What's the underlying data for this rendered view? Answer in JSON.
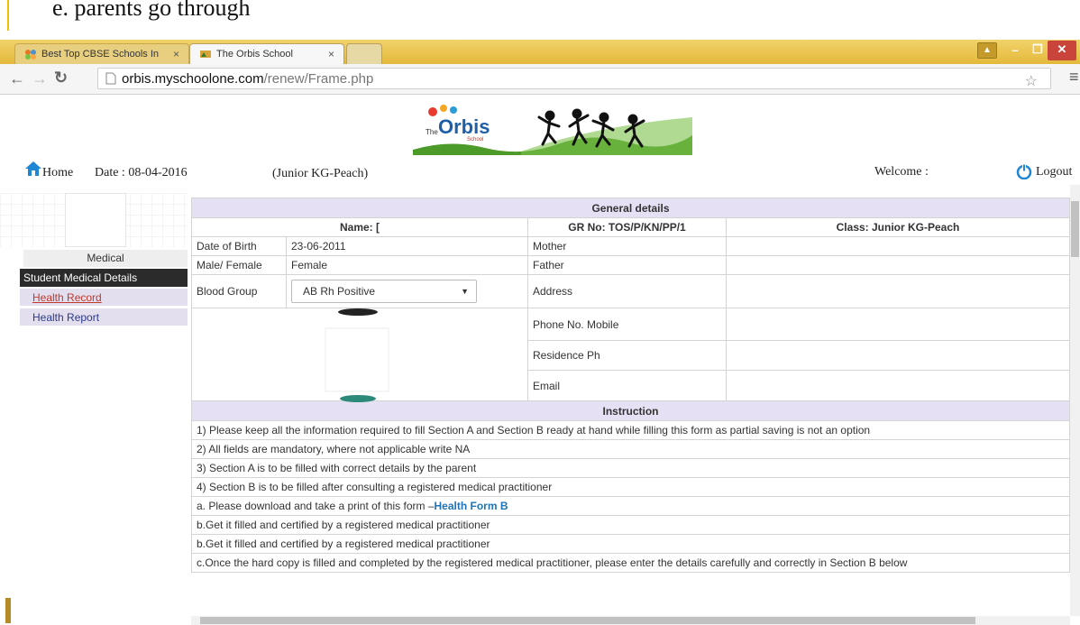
{
  "document_header": {
    "text": "e.    parents go through"
  },
  "browser": {
    "tabs": [
      {
        "title": "Best Top CBSE Schools In",
        "close": "×"
      },
      {
        "title": "The Orbis School",
        "close": "×"
      }
    ],
    "url_host": "orbis.myschoolone.com",
    "url_path": "/renew/Frame.php"
  },
  "logo": {
    "small": "The",
    "main": "Orbis",
    "sub": "School"
  },
  "header": {
    "home": "Home",
    "date": "Date : 08-04-2016",
    "class_label": "(Junior KG-Peach)",
    "welcome": "Welcome :",
    "logout": "Logout"
  },
  "sidebar": {
    "medical": "Medical",
    "section_title": "Student Medical Details",
    "items": [
      {
        "label": "Health Record"
      },
      {
        "label": "Health Report"
      }
    ]
  },
  "general": {
    "title": "General details",
    "name_label": "Name: [",
    "gr_label": "GR No: TOS/P/KN/PP/1",
    "class_label": "Class: Junior KG-Peach",
    "dob_label": "Date of Birth",
    "dob_value": "23-06-2011",
    "gender_label": "Male/ Female",
    "gender_value": "Female",
    "blood_label": "Blood Group",
    "blood_value": "AB Rh Positive",
    "mother_label": "Mother",
    "father_label": "Father",
    "address_label": "Address",
    "phone_label": "Phone No. Mobile",
    "residence_label": "Residence Ph",
    "email_label": "Email"
  },
  "instruction": {
    "title": "Instruction",
    "lines": [
      "1) Please keep all the information required to fill Section A and Section B ready at hand while filling this form as partial saving is not an option",
      "2) All fields are mandatory, where not applicable write NA",
      "3) Section A is to be filled with correct details by the parent",
      "4) Section B is to be filled after consulting a registered medical practitioner",
      "a. Please download and take a print of this form –",
      "b.Get it filled and certified by a registered medical practitioner",
      "b.Get it filled and certified by a registered medical practitioner",
      "c.Once the hard copy is filled and completed by the registered medical practitioner, please enter the details carefully and correctly in Section B below"
    ],
    "download_link": "Health Form B"
  }
}
